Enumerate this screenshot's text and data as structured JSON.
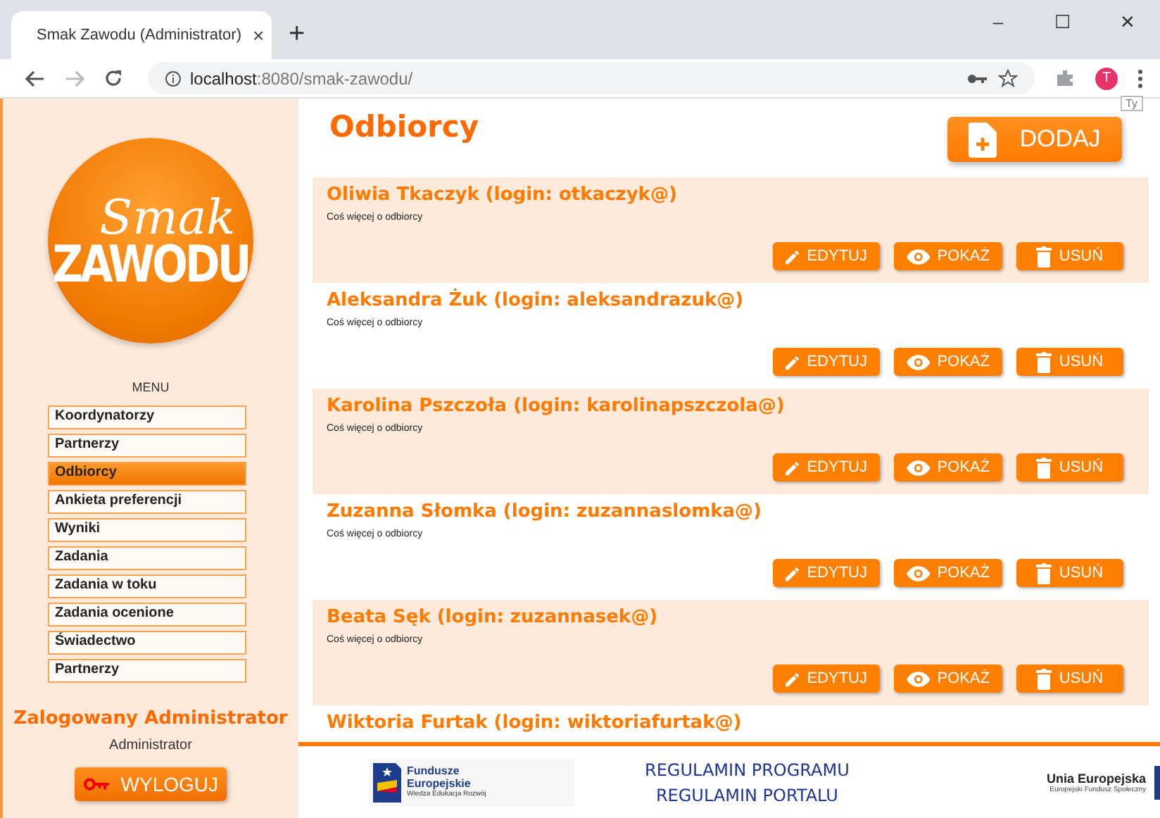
{
  "browser": {
    "tab_title": "Smak Zawodu (Administrator)",
    "tab_close": "×",
    "new_tab": "+",
    "url_host": "localhost",
    "url_path": ":8080/smak-zawodu/",
    "profile": "T",
    "tooltip": "Ty",
    "window_controls": [
      "–",
      "☐",
      "✕"
    ]
  },
  "sidebar": {
    "logo_top": "Smak",
    "logo_bottom": "ZAWODU",
    "menu_title": "MENU",
    "items": [
      {
        "label": "Koordynatorzy",
        "selected": false
      },
      {
        "label": "Partnerzy",
        "selected": false
      },
      {
        "label": "Odbiorcy",
        "selected": true
      },
      {
        "label": "Ankieta preferencji",
        "selected": false
      },
      {
        "label": "Wyniki",
        "selected": false
      },
      {
        "label": "Zadania",
        "selected": false
      },
      {
        "label": "Zadania w toku",
        "selected": false
      },
      {
        "label": "Zadania ocenione",
        "selected": false
      },
      {
        "label": "Świadectwo",
        "selected": false
      },
      {
        "label": "Partnerzy",
        "selected": false
      }
    ],
    "user_heading": "Zalogowany Administrator",
    "user_role": "Administrator",
    "logout": "WYLOGUJ"
  },
  "page": {
    "title": "Odbiorcy",
    "add_button": "DODAJ"
  },
  "recipients": [
    {
      "name": "Oliwia Tkaczyk (login: otkaczyk@)",
      "description": "Coś więcej o odbiorcy",
      "actions": [
        {
          "kind": "edit",
          "label": "EDYTUJ"
        },
        {
          "kind": "view",
          "label": "POKAŻ"
        },
        {
          "kind": "delete",
          "label": "USUŃ"
        }
      ]
    },
    {
      "name": "Aleksandra Żuk (login: aleksandrazuk@)",
      "description": "Coś więcej o odbiorcy",
      "actions": [
        {
          "kind": "edit",
          "label": "EDYTUJ"
        },
        {
          "kind": "view",
          "label": "POKAŻ"
        },
        {
          "kind": "delete",
          "label": "USUŃ"
        }
      ]
    },
    {
      "name": "Karolina Pszczoła (login: karolinapszczola@)",
      "description": "Coś więcej o odbiorcy",
      "actions": [
        {
          "kind": "edit",
          "label": "EDYTUJ"
        },
        {
          "kind": "view",
          "label": "POKAŻ"
        },
        {
          "kind": "delete",
          "label": "USUŃ"
        }
      ]
    },
    {
      "name": "Zuzanna Słomka (login: zuzannaslomka@)",
      "description": "Coś więcej o odbiorcy",
      "actions": [
        {
          "kind": "edit",
          "label": "EDYTUJ"
        },
        {
          "kind": "view",
          "label": "POKAŻ"
        },
        {
          "kind": "delete",
          "label": "USUŃ"
        }
      ]
    },
    {
      "name": "Beata Sęk (login: zuzannasek@)",
      "description": "Coś więcej o odbiorcy",
      "actions": [
        {
          "kind": "edit",
          "label": "EDYTUJ"
        },
        {
          "kind": "view",
          "label": "POKAŻ"
        },
        {
          "kind": "delete",
          "label": "USUŃ"
        }
      ]
    },
    {
      "name": "Wiktoria Furtak (login: wiktoriafurtak@)"
    }
  ],
  "footer": {
    "fe_name": "Fundusze Europejskie",
    "fe_tagline": "Wiedza Edukacja Rozwój",
    "links": [
      "REGULAMIN PROGRAMU",
      "REGULAMIN PORTALU"
    ],
    "eu_name": "Unia Europejska",
    "eu_fund": "Europejski Fundusz Społeczny"
  }
}
